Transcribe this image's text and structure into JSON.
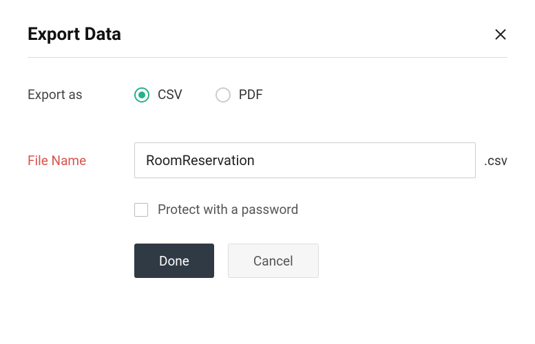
{
  "dialog": {
    "title": "Export Data"
  },
  "exportAs": {
    "label": "Export as",
    "options": {
      "csv": "CSV",
      "pdf": "PDF"
    },
    "selected": "csv"
  },
  "fileName": {
    "label": "File Name",
    "value": "RoomReservation",
    "extension": ".csv"
  },
  "protect": {
    "label": "Protect with a password",
    "checked": false
  },
  "buttons": {
    "done": "Done",
    "cancel": "Cancel"
  }
}
